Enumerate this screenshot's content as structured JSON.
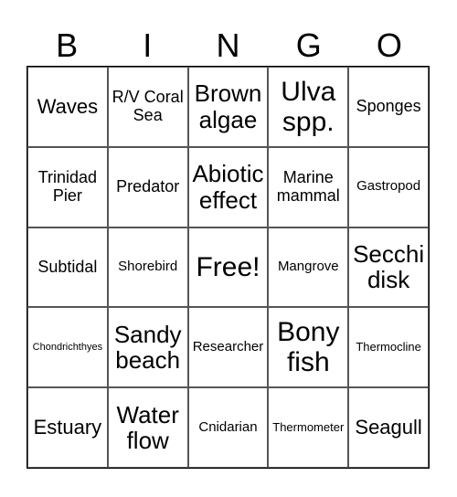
{
  "header": [
    "B",
    "I",
    "N",
    "G",
    "O"
  ],
  "cells": [
    {
      "text": "Waves",
      "size": "xl"
    },
    {
      "text": "R/V Coral Sea",
      "size": "l"
    },
    {
      "text": "Brown algae",
      "size": "xxl"
    },
    {
      "text": "Ulva spp.",
      "size": "xxxl"
    },
    {
      "text": "Sponges",
      "size": "l"
    },
    {
      "text": "Trinidad Pier",
      "size": "l"
    },
    {
      "text": "Predator",
      "size": "l"
    },
    {
      "text": "Abiotic effect",
      "size": "xxl"
    },
    {
      "text": "Marine mammal",
      "size": "l"
    },
    {
      "text": "Gastropod",
      "size": "m"
    },
    {
      "text": "Subtidal",
      "size": "l"
    },
    {
      "text": "Shorebird",
      "size": "m"
    },
    {
      "text": "Free!",
      "size": "xxxl"
    },
    {
      "text": "Mangrove",
      "size": "m"
    },
    {
      "text": "Secchi disk",
      "size": "xxl"
    },
    {
      "text": "Chondrichthyes",
      "size": "xs"
    },
    {
      "text": "Sandy beach",
      "size": "xxl"
    },
    {
      "text": "Researcher",
      "size": "m"
    },
    {
      "text": "Bony fish",
      "size": "xxxl"
    },
    {
      "text": "Thermocline",
      "size": "s"
    },
    {
      "text": "Estuary",
      "size": "xl"
    },
    {
      "text": "Water flow",
      "size": "xxl"
    },
    {
      "text": "Cnidarian",
      "size": "m"
    },
    {
      "text": "Thermometer",
      "size": "s"
    },
    {
      "text": "Seagull",
      "size": "xl"
    }
  ]
}
